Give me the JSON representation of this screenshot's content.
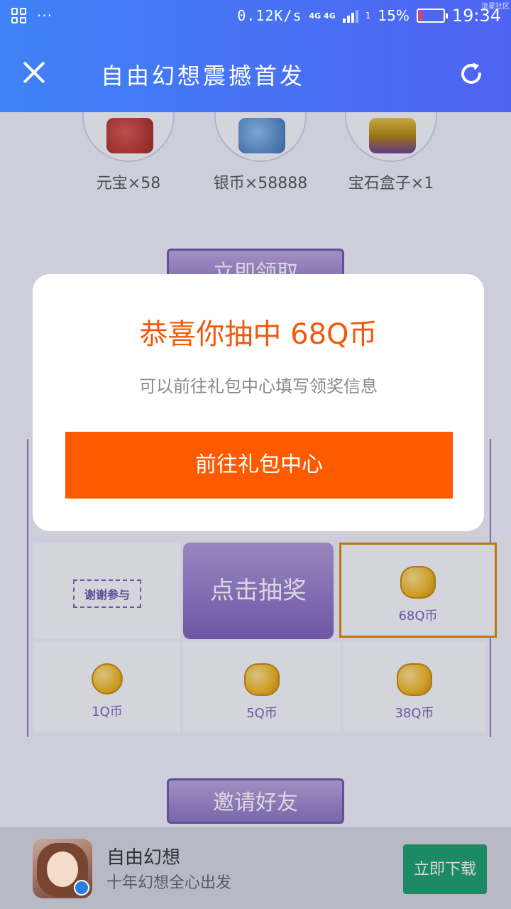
{
  "status_bar": {
    "network_speed": "0.12K/s",
    "network_type": "4G 4G",
    "sim_slot": "1",
    "battery_percent": "15%",
    "battery_level": 0.15,
    "time": "19:34",
    "more_indicator": "···",
    "watermark": "流星社区"
  },
  "title_bar": {
    "title": "自由幻想震撼首发",
    "close_icon": "close-icon",
    "refresh_icon": "refresh-icon"
  },
  "rewards": [
    {
      "label": "元宝×58",
      "icon": "ingot-bag-icon",
      "color": "#c0392b"
    },
    {
      "label": "银币×58888",
      "icon": "silver-bag-icon",
      "color": "#4a90c8"
    },
    {
      "label": "宝石盒子×1",
      "icon": "treasure-chest-icon",
      "color": "#c79a16"
    }
  ],
  "claim_button": "立即领取",
  "draw_grid": {
    "thanks_label": "谢谢参与",
    "center_label": "点击抽奖",
    "prizes": [
      {
        "label": "68Q币",
        "highlighted": true
      },
      {
        "label": "1Q币",
        "highlighted": false
      },
      {
        "label": "5Q币",
        "highlighted": false
      },
      {
        "label": "38Q币",
        "highlighted": false
      }
    ]
  },
  "invite_button": "邀请好友",
  "download_bar": {
    "app_name": "自由幻想",
    "slogan": "十年幻想全心出发",
    "download_label": "立即下载"
  },
  "modal": {
    "title": "恭喜你抽中 68Q币",
    "subtitle": "可以前往礼包中心填写领奖信息",
    "button_label": "前往礼包中心"
  },
  "colors": {
    "header_start": "#3f82f7",
    "header_end": "#4f63f2",
    "accent_orange": "#ff5a00",
    "title_orange": "#f05a0a",
    "download_green": "#1aa06b",
    "purple": "#7a62b0"
  }
}
